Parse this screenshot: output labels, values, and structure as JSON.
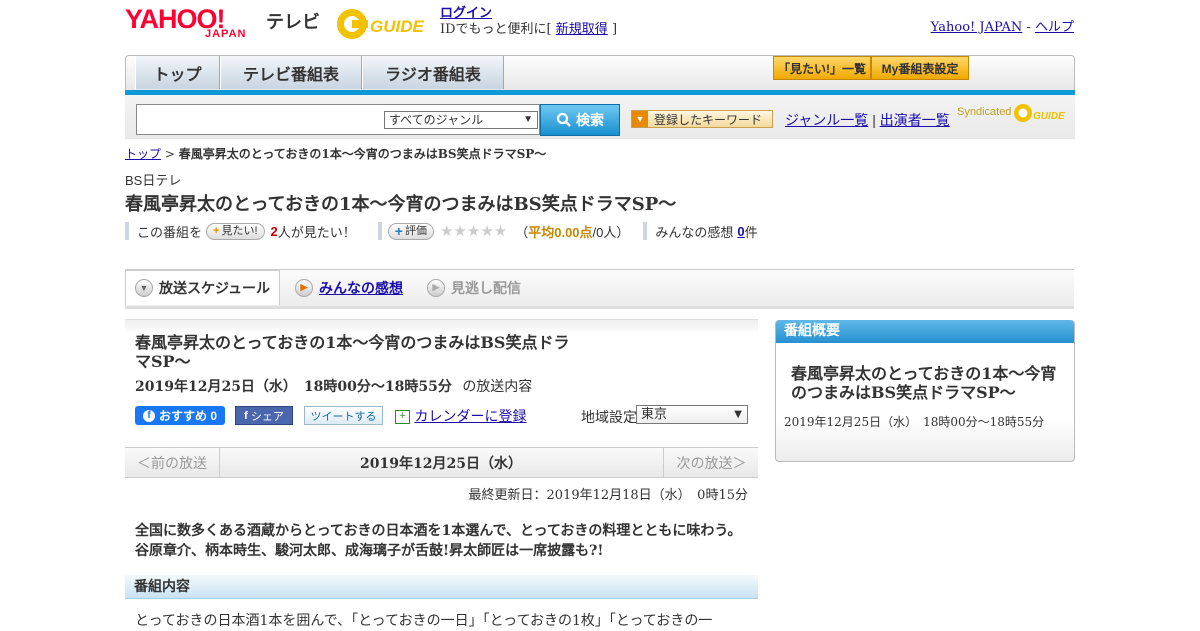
{
  "header": {
    "logo_yahoo": "YAHOO!",
    "logo_japan": "JAPAN",
    "logo_tv": "テレビ",
    "gguide_text": "G-GUIDE",
    "login_label": "ログイン",
    "id_text_prefix": "IDでもっと便利に[",
    "signup_label": "新規取得",
    "id_text_suffix": "]",
    "yahoo_japan_link": "Yahoo! JAPAN",
    "dash": "-",
    "help_link": "ヘルプ"
  },
  "nav": {
    "tabs": [
      {
        "label": "トップ"
      },
      {
        "label": "テレビ番組表"
      },
      {
        "label": "ラジオ番組表"
      }
    ],
    "mitai_list": "「見たい!」一覧",
    "my_schedule": "My番組表設定"
  },
  "search": {
    "input_value": "",
    "genre_selected": "すべてのジャンル",
    "button_label": "検索",
    "keyword_button": "登録したキーワード",
    "genre_list": "ジャンル一覧",
    "separator": "|",
    "performer_list": "出演者一覧",
    "syndicated": "Syndicated"
  },
  "breadcrumb": {
    "top": "トップ",
    "sep": ">",
    "current": "春風亭昇太のとっておきの1本～今宵のつまみはBS笑点ドラマSP～"
  },
  "program": {
    "channel": "BS日テレ",
    "title": "春風亭昇太のとっておきの1本～今宵のつまみはBS笑点ドラマSP～",
    "this_program": "この番組を",
    "mitai_btn": "見たい!",
    "mitai_count": "2",
    "mitai_suffix": "人が見たい！",
    "rate_btn": "評価",
    "avg_prefix": "（",
    "avg_label": "平均0.00点",
    "avg_people": "/0人）",
    "reviews_label": "みんなの感想",
    "reviews_count": "0",
    "reviews_suffix": "件",
    "rating": 0,
    "rating_max": 5
  },
  "tabs": {
    "schedule": "放送スケジュール",
    "reviews": "みんなの感想",
    "missed": "見逃し配信"
  },
  "broadcast": {
    "title": "春風亭昇太のとっておきの1本～今宵のつまみはBS笑点ドラマSP～",
    "date": "2019年12月25日（水）　18時00分～18時55分",
    "date_suffix": "の放送内容",
    "fb_recommend": "おすすめ 0",
    "fb_share": "シェア",
    "tweet": "ツイートする",
    "calendar": "カレンダーに登録",
    "region_label": "地域設定",
    "region_value": "東京"
  },
  "pager": {
    "prev": "＜前の放送",
    "date": "2019年12月25日（水）",
    "next": "次の放送＞"
  },
  "updated": "最終更新日：2019年12月18日（水）　0時15分",
  "summary": "全国に数多くある酒蔵からとっておきの日本酒を1本選んで、とっておきの料理とともに味わう。谷原章介、柄本時生、駿河太郎、成海璃子が舌鼓!昇太師匠は一席披露も?!",
  "content_section": {
    "heading": "番組内容",
    "text": "とっておきの日本酒1本を囲んで、「とっておきの一日」「とっておきの1枚」「とっておきの一"
  },
  "sidebar": {
    "heading": "番組概要",
    "title": "春風亭昇太のとっておきの1本～今宵のつまみはBS笑点ドラマSP～",
    "date": "2019年12月25日（水）　18時00分～18時55分"
  },
  "colors": {
    "accent_blue": "#0e9ad6",
    "brand_red": "#ff0033",
    "gold": "#f0a800"
  }
}
